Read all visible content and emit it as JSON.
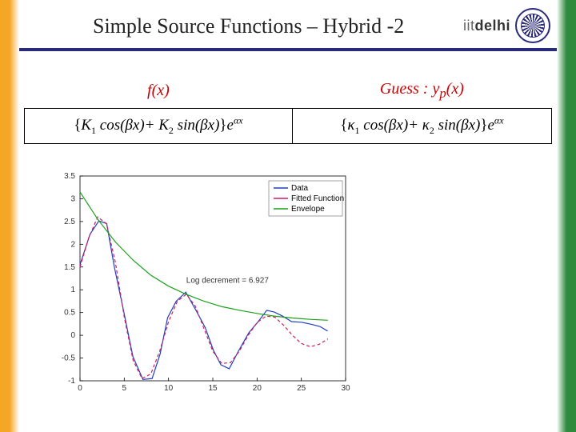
{
  "header": {
    "title": "Simple Source Functions – Hybrid -2",
    "brand_iit": "iit",
    "brand_delhi": "delhi"
  },
  "table": {
    "h1": "f(x)",
    "h2_prefix": "Guess : ",
    "h2_fn": "y",
    "h2_sub": "p",
    "h2_arg": "(x)",
    "left_formula": "{K₁ cos(βx) + K₂ sin(βx)} e^{αx}",
    "right_formula": "{κ₁ cos(βx) + κ₂ sin(βx)} e^{αx}"
  },
  "chart_data": {
    "type": "line",
    "title": "",
    "xlabel": "",
    "ylabel": "",
    "xlim": [
      0,
      30
    ],
    "ylim": [
      -1,
      3.5
    ],
    "x_ticks": [
      0,
      5,
      10,
      15,
      20,
      25,
      30
    ],
    "y_ticks": [
      -1,
      -0.5,
      0,
      0.5,
      1,
      1.5,
      2,
      2.5,
      3,
      3.5
    ],
    "annotation": "Log decrement = 6.927",
    "legend": [
      "Data",
      "Fitted Function",
      "Envelope"
    ],
    "colors": {
      "data": "#1f3fbf",
      "fitted": "#d11a63",
      "envelope": "#1aa01a"
    },
    "series": [
      {
        "name": "Fitted Function",
        "x": [
          0,
          1,
          2,
          3,
          4,
          5,
          6,
          7,
          8,
          9,
          10,
          11,
          12,
          13,
          14,
          15,
          16,
          17,
          18,
          19,
          20,
          21,
          22,
          23,
          24,
          25,
          26,
          27,
          28
        ],
        "y": [
          1.5,
          2.15,
          2.6,
          2.45,
          1.6,
          0.4,
          -0.55,
          -0.95,
          -0.85,
          -0.35,
          0.3,
          0.75,
          0.9,
          0.65,
          0.15,
          -0.35,
          -0.62,
          -0.6,
          -0.35,
          0.0,
          0.28,
          0.42,
          0.4,
          0.22,
          0.0,
          -0.18,
          -0.25,
          -0.2,
          -0.08
        ]
      },
      {
        "name": "Data",
        "x": [
          0,
          1,
          2,
          3,
          4,
          5,
          6,
          7,
          8,
          9,
          10,
          11,
          12,
          13,
          14,
          15,
          16,
          17,
          18,
          19,
          20,
          21,
          22,
          23,
          24,
          25,
          26,
          27,
          28
        ],
        "y": [
          1.5,
          2.2,
          2.55,
          2.5,
          1.5,
          0.55,
          -0.5,
          -0.95,
          -0.9,
          -0.4,
          0.35,
          0.7,
          0.95,
          0.6,
          0.2,
          -0.35,
          -0.7,
          -0.75,
          -0.3,
          0.1,
          0.3,
          0.5,
          0.48,
          0.45,
          0.35,
          0.3,
          0.2,
          0.15,
          0.1
        ]
      },
      {
        "name": "Envelope",
        "x": [
          0,
          2,
          4,
          6,
          8,
          10,
          12,
          14,
          16,
          18,
          20,
          22,
          24,
          26,
          28
        ],
        "y": [
          3.15,
          2.55,
          2.05,
          1.65,
          1.32,
          1.08,
          0.9,
          0.75,
          0.63,
          0.55,
          0.48,
          0.42,
          0.38,
          0.35,
          0.33
        ]
      }
    ]
  }
}
